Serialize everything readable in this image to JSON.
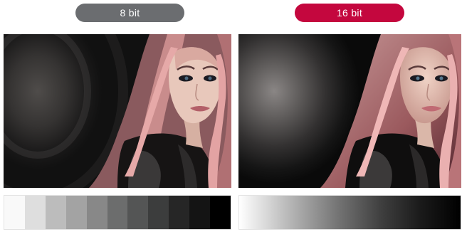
{
  "labels": {
    "left": "8 bit",
    "right": "16 bit"
  },
  "colors": {
    "left_label_bg": "#6b6d70",
    "right_label_bg": "#c4073e"
  },
  "gradient_steps_8bit": [
    "#f9f9f9",
    "#dedede",
    "#bcbcbc",
    "#a3a3a3",
    "#888888",
    "#6c6d6d",
    "#545555",
    "#3c3d3d",
    "#262626",
    "#141414",
    "#000000"
  ]
}
